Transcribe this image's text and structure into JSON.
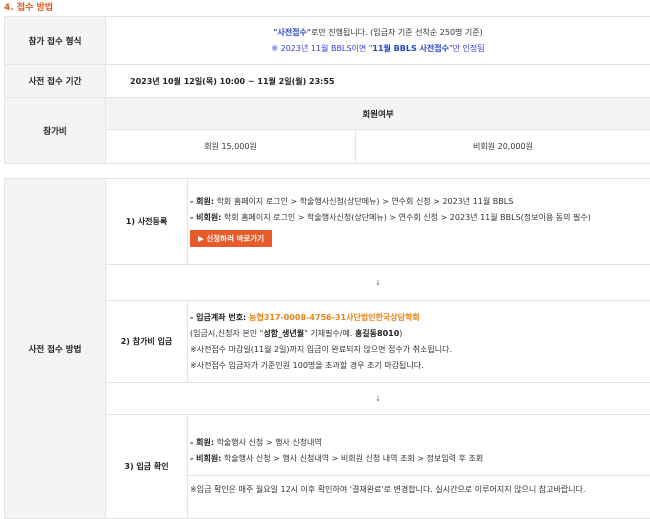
{
  "section_title": "4. 접수 방법",
  "form": {
    "label": "참가 접수 형식",
    "line1_strong": "\"사전접수\"",
    "line1_rest": "로만 진행됩니다. (입금자 기준 선착순 250명 기준)",
    "line2_prefix": "※ 2023년 11월 BBLS이면 \"",
    "line2_strong": "11월 BBLS 사전접수",
    "line2_suffix": "\"만 인정됨"
  },
  "period": {
    "label": "사전 접수 기간",
    "value": "2023년 10월 12일(목) 10:00 ~ 11월 2일(월) 23:55"
  },
  "fee": {
    "label": "참가비",
    "header": "회원여부",
    "member": "회원 15,000원",
    "nonmember": "비회원 20,000원"
  },
  "method": {
    "label": "사전 접수 방법",
    "step1": {
      "label": "1) 사전등록",
      "member_key": "- 회원:",
      "member_val": " 학회 홈페이지 로그인 > 학술행사신청(상단메뉴) > 연수회 신청 > 2023년 11월 BBLS",
      "nonmember_key": "- 비회원:",
      "nonmember_val": " 학회 홈페이지 로그인 > 학술행사신청(상단메뉴) > 연수회 신청 > 2023년 11월 BBLS(정보이용 동의 필수)",
      "button": "▶ 신청하러 바로가기"
    },
    "arrow": "↓",
    "step2": {
      "label": "2) 참가비 입금",
      "account_key": "- 입금계좌 번호:",
      "account_val": " 농협317-0008-4756-31사단법인한국상담학회",
      "note1_pre": "(입금시,신청자 본인 \"",
      "note1_strong1": "성함_생년월",
      "note1_mid": "\" 기재필수/예. ",
      "note1_strong2": "홍길동8010",
      "note1_end": ")",
      "note2": "※사전접수 마감일(11월 2일)까지 입금이 완료되지 않으면 접수가 취소됩니다.",
      "note3": "※사전접수 입금자가 기준인원 100명을 초과할 경우 조기 마감됩니다."
    },
    "step3": {
      "label": "3) 입금 확인",
      "member_key": "- 회원:",
      "member_val": " 학술행사 신청 > 행사 신청내역",
      "nonmember_key": "- 비회원:",
      "nonmember_val": " 학술행사 신청 > 행사 신청내역 > 비회원 신청 내역 조회 > 정보입력 후 조회",
      "note": "※입금 확인은 매주 월요일 12시 이후 확인하여 '결재완료'로 변경합니다. 실시간으로 이루어지지 않으니 참고바랍니다."
    }
  }
}
